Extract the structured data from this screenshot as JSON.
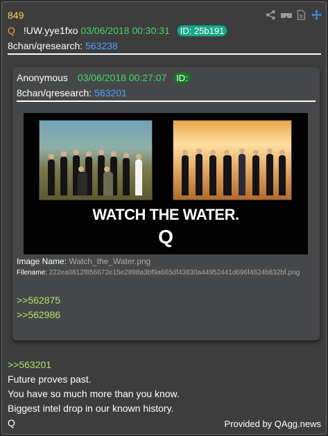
{
  "post": {
    "number": "849",
    "q_label": "Q",
    "tripcode": "!UW.yye1fxo",
    "date": "03/06/2018 00:30:31",
    "id_label": "ID: 25b191",
    "board": "8chan/qresearch:",
    "post_id": "563238"
  },
  "icons": [
    "share-icon",
    "glasses-icon",
    "document-icon",
    "move-icon"
  ],
  "quoted": {
    "author": "Anonymous",
    "date": "03/06/2018 00:27:07",
    "id_label": "ID:",
    "board": "8chan/qresearch:",
    "post_id": "563201",
    "image_text_main": "WATCH THE WATER.",
    "image_text_sub": "Q",
    "image_name_label": "Image Name:",
    "image_name": "Watch_the_Water.png",
    "filename_label": "Filename:",
    "filename": "222ea0812f856672e15e2898a3bf9a665df43830a44952441d696f4624b832bf.png",
    "refs": [
      ">>562875",
      ">>562986"
    ]
  },
  "message": {
    "reply_ref": ">>563201",
    "lines": [
      "Future proves past.",
      "You have so much more than you know.",
      "Biggest intel drop in our known history.",
      "Q"
    ]
  },
  "footer": "Provided by QAgg.news",
  "colors": {
    "background": "#3d3d3e",
    "post_number": "#ffd24a",
    "q": "#ff9640",
    "date": "#43d96b",
    "link": "#4fa0ff",
    "greentext": "#b5e06c",
    "id_pill": "#19a88a",
    "id_pill_quoted": "#157a22"
  }
}
